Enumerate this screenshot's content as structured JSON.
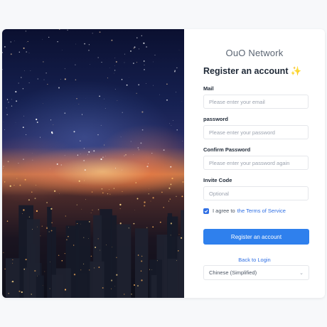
{
  "brand": "OuO Network",
  "heading": "Register an account",
  "heading_icon": "✨",
  "fields": {
    "mail": {
      "label": "Mail",
      "placeholder": "Please enter your email"
    },
    "password": {
      "label": "password",
      "placeholder": "Please enter your password"
    },
    "confirm": {
      "label": "Confirm Password",
      "placeholder": "Please enter your password again"
    },
    "invite": {
      "label": "Invite Code",
      "placeholder": "Optional"
    }
  },
  "agree": {
    "text": "I agree to",
    "link": "the Terms of Service",
    "checked": true
  },
  "register_button": "Register an account",
  "back_link": "Back to Login",
  "language": {
    "selected": "Chinese (Simplified)"
  },
  "colors": {
    "primary": "#2f80ed",
    "link": "#2f6fe4",
    "background": "#f7f8fa"
  }
}
